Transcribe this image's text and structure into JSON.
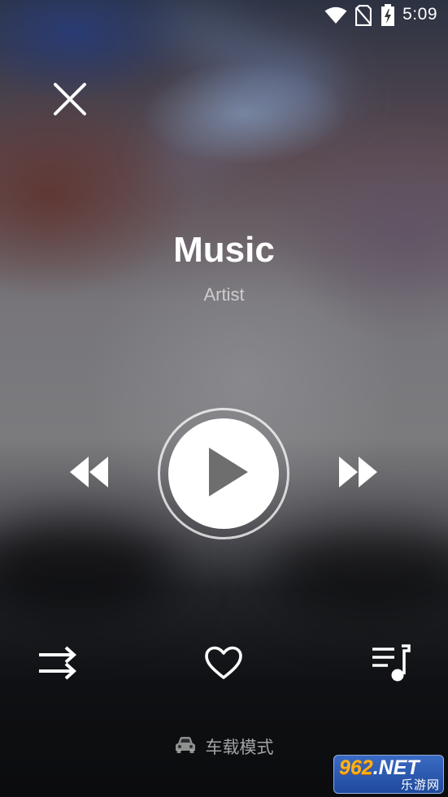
{
  "status_bar": {
    "time": "5:09",
    "icons": [
      "wifi-icon",
      "no-sim-icon",
      "battery-charging-icon"
    ]
  },
  "player": {
    "close_icon": "close-icon",
    "song_title": "Music",
    "artist": "Artist",
    "controls": {
      "previous_icon": "rewind-icon",
      "play_icon": "play-icon",
      "next_icon": "fast-forward-icon"
    },
    "actions": {
      "play_order_icon": "shuffle-icon",
      "favorite_icon": "heart-icon",
      "playlist_icon": "playlist-music-icon"
    },
    "car_mode": {
      "icon": "car-icon",
      "label": "车载模式"
    }
  },
  "watermark": {
    "number": "962",
    "suffix": ".NET",
    "subtitle": "乐游网"
  },
  "colors": {
    "watermark_blue": "#2a5bb5",
    "watermark_orange": "#ffb21a",
    "control_white": "#ffffff"
  }
}
